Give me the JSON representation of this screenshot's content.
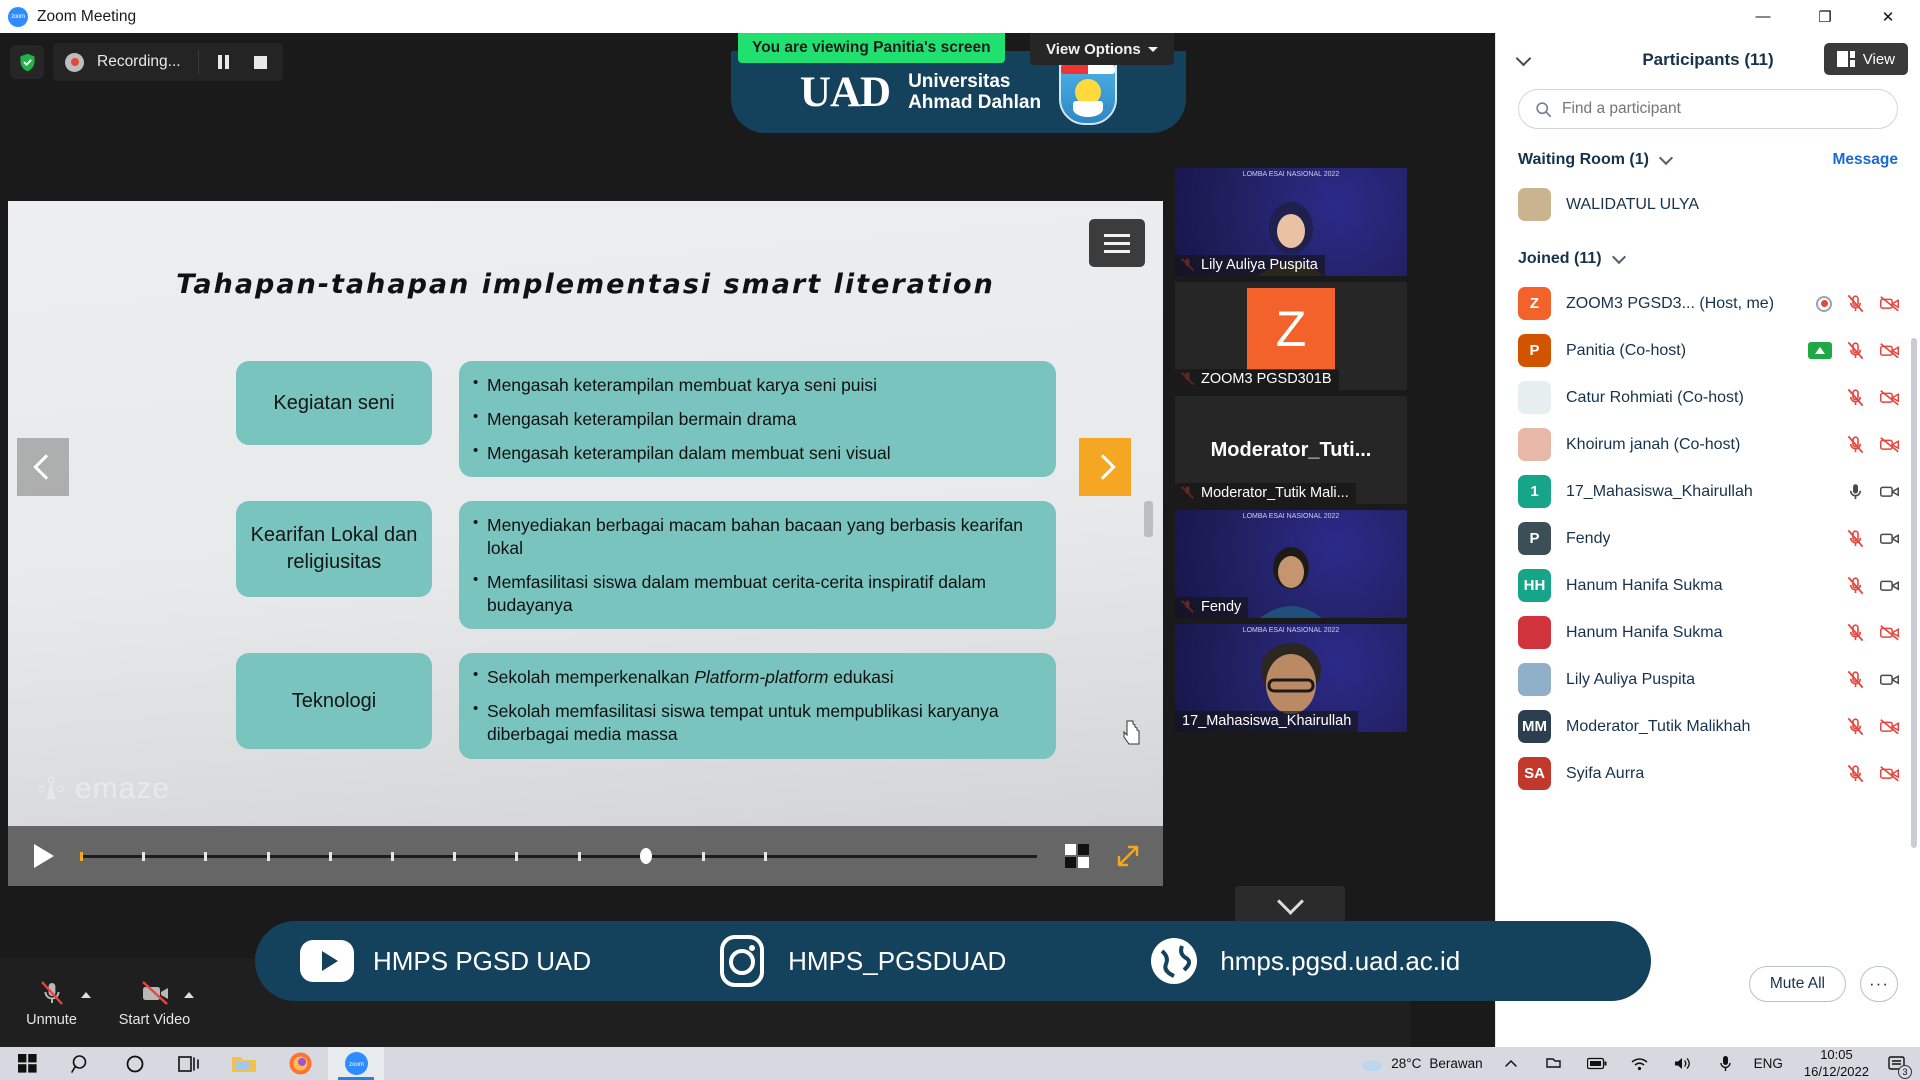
{
  "window": {
    "app_title": "Zoom Meeting",
    "minimize": "—",
    "maximize": "❐",
    "close": "✕"
  },
  "recording": {
    "status_label": "Recording...",
    "pause_icon": "pause-icon",
    "stop_icon": "stop-icon",
    "shield_icon": "security-shield-icon"
  },
  "share_banner": {
    "viewing_text": "You are viewing Panitia's screen",
    "view_options_label": "View Options",
    "view_button_label": "View"
  },
  "uad_header": {
    "mark": "UAD",
    "line1": "Universitas",
    "line2": "Ahmad Dahlan"
  },
  "slide": {
    "title": "Tahapan-tahapan implementasi smart literation",
    "watermark": "emaze",
    "rows": [
      {
        "label": "Kegiatan seni",
        "bullets": [
          "Mengasah keterampilan membuat karya seni puisi",
          "Mengasah keterampilan bermain drama",
          "Mengasah keterampilan dalam membuat seni visual"
        ]
      },
      {
        "label": "Kearifan Lokal dan religiusitas",
        "bullets": [
          "Menyediakan berbagai macam bahan bacaan yang berbasis kearifan lokal",
          "Memfasilitasi siswa dalam membuat cerita-cerita inspiratif dalam budayanya"
        ]
      },
      {
        "label": "Teknologi",
        "bullets": [
          "Sekolah memperkenalkan Platform-platform edukasi",
          "Sekolah memfasilitasi siswa tempat untuk mempublikasi karyanya diberbagai media massa"
        ]
      }
    ]
  },
  "player": {
    "play_icon": "play-icon",
    "grid_icon": "grid-view-icon",
    "fullscreen_icon": "fullscreen-icon"
  },
  "thumbnails": [
    {
      "name": "Lily Auliya Puspita",
      "banner": "LOMBA ESAI NASIONAL 2022",
      "type": "video",
      "muted": true,
      "active": false
    },
    {
      "name": "ZOOM3 PGSD301B",
      "initial": "Z",
      "type": "avatar",
      "muted": true,
      "active": false
    },
    {
      "name": "Moderator_Tutik Mali...",
      "display": "Moderator_Tuti...",
      "type": "name-only",
      "muted": true,
      "active": false
    },
    {
      "name": "Fendy",
      "banner": "LOMBA ESAI NASIONAL 2022",
      "type": "video",
      "muted": true,
      "active": false
    },
    {
      "name": "17_Mahasiswa_Khairullah",
      "banner": "LOMBA ESAI NASIONAL 2022",
      "type": "video",
      "muted": false,
      "active": true
    }
  ],
  "participants_panel": {
    "title": "Participants (11)",
    "search_placeholder": "Find a participant",
    "waiting_room": {
      "title": "Waiting Room (1)",
      "message_link": "Message",
      "items": [
        {
          "name": "WALIDATUL ULYA",
          "avatar_type": "image",
          "avatar_color": "#c9b48f"
        }
      ]
    },
    "joined": {
      "title": "Joined (11)",
      "items": [
        {
          "name": "ZOOM3 PGSD3...",
          "role": "(Host, me)",
          "initial": "Z",
          "avatar_color": "#f2622a",
          "recording": true,
          "mic": "muted",
          "cam": "off"
        },
        {
          "name": "Panitia (Co-host)",
          "initial": "P",
          "avatar_color": "#d35400",
          "sharing": true,
          "mic": "muted",
          "cam": "off"
        },
        {
          "name": "Catur Rohmiati (Co-host)",
          "avatar_type": "image",
          "avatar_color": "#e7eef0",
          "mic": "muted",
          "cam": "off"
        },
        {
          "name": "Khoirum janah (Co-host)",
          "avatar_type": "image",
          "avatar_color": "#e8b9a8",
          "mic": "muted",
          "cam": "off"
        },
        {
          "name": "17_Mahasiswa_Khairullah",
          "initial": "1",
          "avatar_color": "#17a589",
          "mic": "on",
          "cam": "on"
        },
        {
          "name": "Fendy",
          "initial": "P",
          "avatar_color": "#3d4f56",
          "mic": "muted",
          "cam": "on"
        },
        {
          "name": "Hanum Hanifa Sukma",
          "initial": "HH",
          "avatar_color": "#17a589",
          "mic": "muted",
          "cam": "on"
        },
        {
          "name": "Hanum Hanifa Sukma",
          "avatar_type": "image",
          "avatar_color": "#d0333c",
          "mic": "muted",
          "cam": "off"
        },
        {
          "name": "Lily Auliya Puspita",
          "avatar_type": "image",
          "avatar_color": "#8fb0c8",
          "mic": "muted",
          "cam": "on"
        },
        {
          "name": "Moderator_Tutik Malikhah",
          "initial": "MM",
          "avatar_color": "#2c3e50",
          "mic": "muted",
          "cam": "off"
        },
        {
          "name": "Syifa Aurra",
          "initial": "SA",
          "avatar_color": "#c0392b",
          "mic": "muted",
          "cam": "off"
        }
      ]
    },
    "footer": {
      "mute_all_label": "Mute All",
      "more_label": "···"
    }
  },
  "zoom_toolbar": {
    "items": [
      {
        "label": "Unmute",
        "icon": "mic-muted-icon",
        "caret": true
      },
      {
        "label": "Start Video",
        "icon": "camera-off-icon",
        "caret": true
      }
    ]
  },
  "social_banner": {
    "items": [
      {
        "icon": "youtube-icon",
        "handle": "HMPS PGSD UAD"
      },
      {
        "icon": "instagram-icon",
        "handle": "HMPS_PGSDUAD"
      },
      {
        "icon": "website-globe-icon",
        "handle": "hmps.pgsd.uad.ac.id"
      }
    ]
  },
  "taskbar": {
    "start_icon": "windows-start-icon",
    "search_icon": "search-icon",
    "cortana_icon": "cortana-icon",
    "taskview_icon": "task-view-icon",
    "apps": [
      "file-explorer-icon",
      "firefox-icon",
      "zoom-icon"
    ],
    "weather": {
      "temperature": "28°C",
      "condition": "Berawan"
    },
    "language": "ENG",
    "time": "10:05",
    "date": "16/12/2022",
    "notification_count": "3"
  },
  "colors": {
    "zoom_blue": "#2d8cff",
    "share_green": "#20e070",
    "uad_navy": "#14415c",
    "slide_teal": "#79c4bf",
    "accent_orange": "#f5a623",
    "panel_text": "#17334c"
  }
}
